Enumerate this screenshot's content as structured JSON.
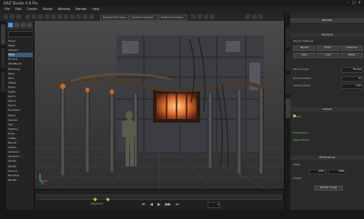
{
  "window": {
    "title": "DAZ Studio 4.6 Pro",
    "minimize": "–",
    "maximize": "□",
    "close": "✕"
  },
  "menubar": [
    "File",
    "Edit",
    "Create",
    "Studio",
    "Window",
    "Render",
    "Help"
  ],
  "toolbar": {
    "view_select": "Perspective View",
    "drawstyle_select": "Texture Shaded",
    "camera_select": "Default Camera"
  },
  "scene_tree": {
    "items": [
      "Scene",
      "Stage",
      "Ambient",
      "Walls",
      "Furnace",
      "WorkBench",
      "Machinery",
      "Pipes",
      "Rack",
      "Chains",
      "Hooks",
      "Lights",
      "Spot 1",
      "Spot 2",
      "Spot 3",
      "Fog Plane",
      "Figure",
      "Genesis",
      "Hair",
      "Clothing",
      "Props",
      "Crates",
      "Barrels",
      "Cables",
      "Camera 1",
      "Camera 2",
      "Smoke",
      "Sparks",
      "Ground",
      "Backdrop",
      "Render"
    ],
    "selected_index": 3
  },
  "timeline": {
    "frame_label": "Playback",
    "frame_value": "0"
  },
  "transport": [
    "⏮",
    "◀",
    "▶",
    "▶▶",
    "⏭"
  ],
  "right_panel": {
    "header": "Render",
    "section_general": "General",
    "preset_label": "Render Settings",
    "buttons_row1": [
      "Render",
      "Editor",
      "Advanced"
    ],
    "buttons_row2": [
      "Save",
      "Load",
      "Reset"
    ],
    "fields": [
      {
        "label": "Render Type",
        "value": "Bucket"
      },
      {
        "label": "Pixel Samples",
        "value": "12"
      },
      {
        "label": "Shading Rate",
        "value": "0.20"
      }
    ],
    "section_output": "Output",
    "output_rows": [
      "Image",
      "Dimensions",
      "Aspect Ratio"
    ],
    "section_dimensions": "Dimensions",
    "dim_labels": [
      "Width",
      "Height"
    ],
    "dim_values": [
      "1920",
      "1080"
    ],
    "render_button": "Render Image"
  },
  "right_tabs": [
    "Scene",
    "Surfaces",
    "Parameters",
    "Render"
  ],
  "colors": {
    "accent": "#3aa1ff",
    "key": "#d6b34a",
    "green_label": "#79c463"
  }
}
